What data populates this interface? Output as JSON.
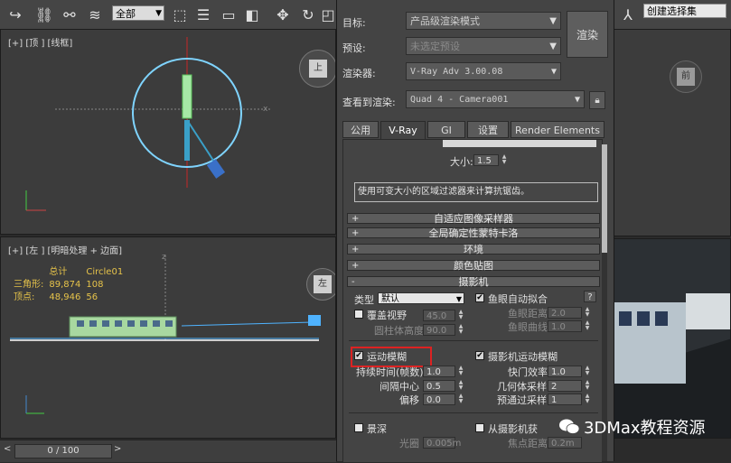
{
  "toolbar": {
    "selection_filter": "全部",
    "named_selection": "创建选择集"
  },
  "viewports": {
    "top": {
      "label": "[+] [顶 ] [线框]"
    },
    "left": {
      "label": "[+] [左 ] [明暗处理 + 边面]",
      "stats": {
        "header_total": "总计",
        "header_object": "Circle01",
        "rows": [
          {
            "name": "三角形:",
            "total": "89,874",
            "object": "108"
          },
          {
            "name": "顶点:",
            "total": "48,946",
            "object": "56"
          }
        ]
      },
      "viewcube": "左"
    },
    "right_top_viewcube": "前"
  },
  "timeline": {
    "frame": "0 / 100"
  },
  "render_dialog": {
    "target_label": "目标:",
    "target_value": "产品级渲染模式",
    "preset_label": "预设:",
    "preset_value": "未选定预设",
    "renderer_label": "渲染器:",
    "renderer_value": "V-Ray Adv 3.00.08",
    "view_label": "查看到渲染:",
    "view_value": "Quad 4 - Camera001",
    "render_button": "渲染",
    "tabs": [
      "公用",
      "V-Ray",
      "GI",
      "设置",
      "Render Elements"
    ],
    "active_tab": "V-Ray",
    "filter": {
      "size_label": "大小:",
      "size_value": "1.5",
      "description": "使用可变大小的区域过滤器来计算抗锯齿。"
    },
    "rollouts": [
      "自适应图像采样器",
      "全局确定性蒙特卡洛",
      "环境",
      "颜色贴图",
      "摄影机"
    ],
    "camera": {
      "type_label": "类型",
      "type_value": "默认",
      "fisheye_auto_fit": "鱼眼自动拟合",
      "override_fov": "覆盖视野",
      "fov_value": "45.0",
      "fisheye_dist_label": "鱼眼距离",
      "fisheye_dist_value": "2.0",
      "cylinder_height_label": "圆柱体高度",
      "cylinder_height_value": "90.0",
      "fisheye_curve_label": "鱼眼曲线",
      "fisheye_curve_value": "1.0",
      "motion_blur": "运动模糊",
      "camera_motion_blur": "摄影机运动模糊",
      "duration_label": "持续时间(帧数)",
      "duration_value": "1.0",
      "shutter_eff_label": "快门效率",
      "shutter_eff_value": "1.0",
      "interval_center_label": "间隔中心",
      "interval_center_value": "0.5",
      "geo_samples_label": "几何体采样",
      "geo_samples_value": "2",
      "bias_label": "偏移",
      "bias_value": "0.0",
      "prepass_samples_label": "预通过采样",
      "prepass_samples_value": "1",
      "dof": "景深",
      "from_camera": "从摄影机获",
      "aperture_label": "光圈",
      "aperture_value": "0.005m",
      "focus_dist_label": "焦点距离",
      "focus_dist_value": "0.2m",
      "help": "?"
    }
  },
  "watermark": "3DMax教程资源",
  "colors": {
    "highlight": "#dd2222",
    "stats": "#e6c34a",
    "circle": "#7fd4ff"
  }
}
